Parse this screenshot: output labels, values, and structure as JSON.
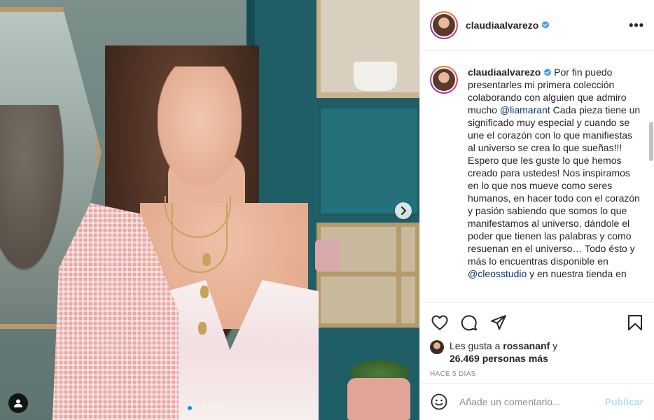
{
  "post": {
    "username": "claudiaalvarezo",
    "verified": true,
    "more_label": "•••"
  },
  "caption": {
    "author": "claudiaalvarezo",
    "text_1": "Por fin puedo presentarles mi primera colección colaborando con alguien que admiro mucho ",
    "mention_1": "@liamarant",
    "text_2": " Cada pieza tiene un significado muy especial y cuando se une el corazón con lo que manifiestas al universo se crea lo que sueñas!!!\nEspero que les guste lo que hemos creado para ustedes! Nos inspiramos en lo que nos mueve como seres humanos, en hacer todo con el corazón y pasión sabiendo que somos lo que manifestamos al universo, dándole el poder que tienen las palabras y como resuenan en el universo… Todo ésto y más lo encuentras disponible en ",
    "mention_2": "@cleosstudio",
    "text_3": " y en nuestra tienda en"
  },
  "likes": {
    "prefix": "Les gusta a ",
    "user": "rossananf",
    "conjunction": " y",
    "count": "26.469 personas más"
  },
  "time": "HACE 5 DÍAS",
  "comment": {
    "placeholder": "Añade un comentario...",
    "publish_label": "Publicar"
  },
  "carousel": {
    "total": 6,
    "active_index": 0
  },
  "colors": {
    "accent": "#0095f6",
    "mention": "#00376b",
    "publish_disabled": "#b2dffc",
    "muted": "#8e8e8e"
  },
  "icons": [
    "verified-badge-icon",
    "more-options-icon",
    "heart-icon",
    "comment-icon",
    "share-icon",
    "bookmark-icon",
    "emoji-icon",
    "chevron-right-icon",
    "user-tag-icon"
  ]
}
